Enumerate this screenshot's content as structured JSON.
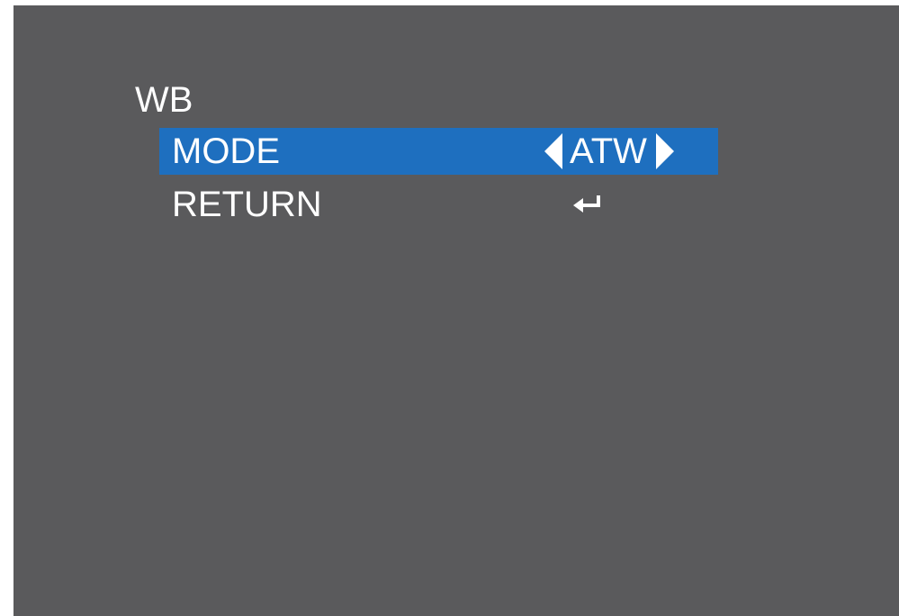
{
  "menu": {
    "title": "WB",
    "items": [
      {
        "label": "MODE",
        "value": "ATW",
        "selected": true
      },
      {
        "label": "RETURN",
        "icon": "enter-icon",
        "selected": false
      }
    ]
  },
  "colors": {
    "background": "#5a5a5c",
    "highlight": "#1e6fbf",
    "text": "#ffffff"
  }
}
